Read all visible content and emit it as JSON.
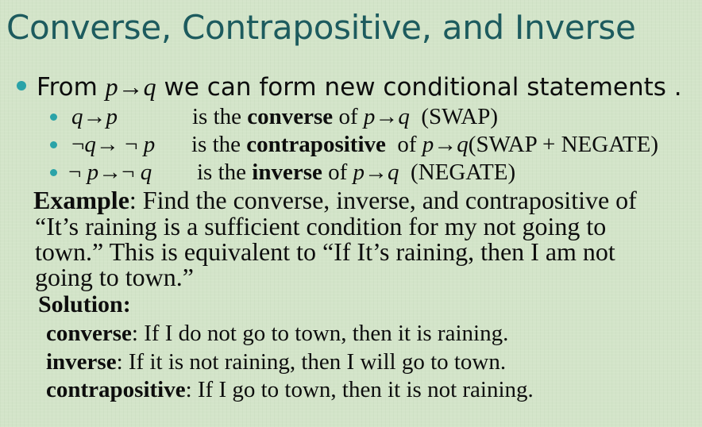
{
  "title": "Converse, Contrapositive, and Inverse",
  "intro": {
    "text_before": "From ",
    "formula": {
      "p": "p",
      "arrow": "→",
      "q": "q"
    },
    "text_after": " we can form new conditional statements ."
  },
  "items": [
    {
      "formula": {
        "a": "q",
        "arrow": "→",
        "b": "p"
      },
      "is_the": "is the ",
      "term": "converse",
      "of": " of ",
      "ref": {
        "p": "p",
        "arrow": "→",
        "q": "q"
      },
      "note": "(SWAP)"
    },
    {
      "formula": {
        "neg1": "¬",
        "a": "q",
        "arrow": "→",
        "neg2": "¬",
        "b": "p"
      },
      "is_the": "is the ",
      "term": "contrapositive",
      "of": " of ",
      "ref": {
        "p": "p",
        "arrow": "→",
        "q": "q"
      },
      "note": "(SWAP + NEGATE)"
    },
    {
      "formula": {
        "neg1": "¬",
        "a": "p",
        "arrow": "→",
        "neg2": "¬",
        "b": "q"
      },
      "is_the": "is the ",
      "term": "inverse",
      "of": " of ",
      "ref": {
        "p": "p",
        "arrow": "→",
        "q": "q"
      },
      "note": "(NEGATE)"
    }
  ],
  "example": {
    "label": "Example",
    "line1": ": Find the converse, inverse, and contrapositive of",
    "line2": "“It’s raining is a sufficient condition for my not going to",
    "line3": "town.” This is equivalent to “If It’s raining, then I am not",
    "line4": "going to town.”"
  },
  "solution": {
    "label": "Solution:",
    "rows": [
      {
        "term": "converse",
        "text": ": If I do not go to town, then it is  raining."
      },
      {
        "term": "inverse",
        "text": ":  If it is not raining, then I will go to town."
      },
      {
        "term": "contrapositive",
        "text": ": If I go to town, then it is not raining."
      }
    ]
  },
  "colors": {
    "background": "#d3e4c9",
    "title": "#1d5b5e",
    "bullet": "#2aa3a8",
    "text": "#0d0d0d"
  }
}
